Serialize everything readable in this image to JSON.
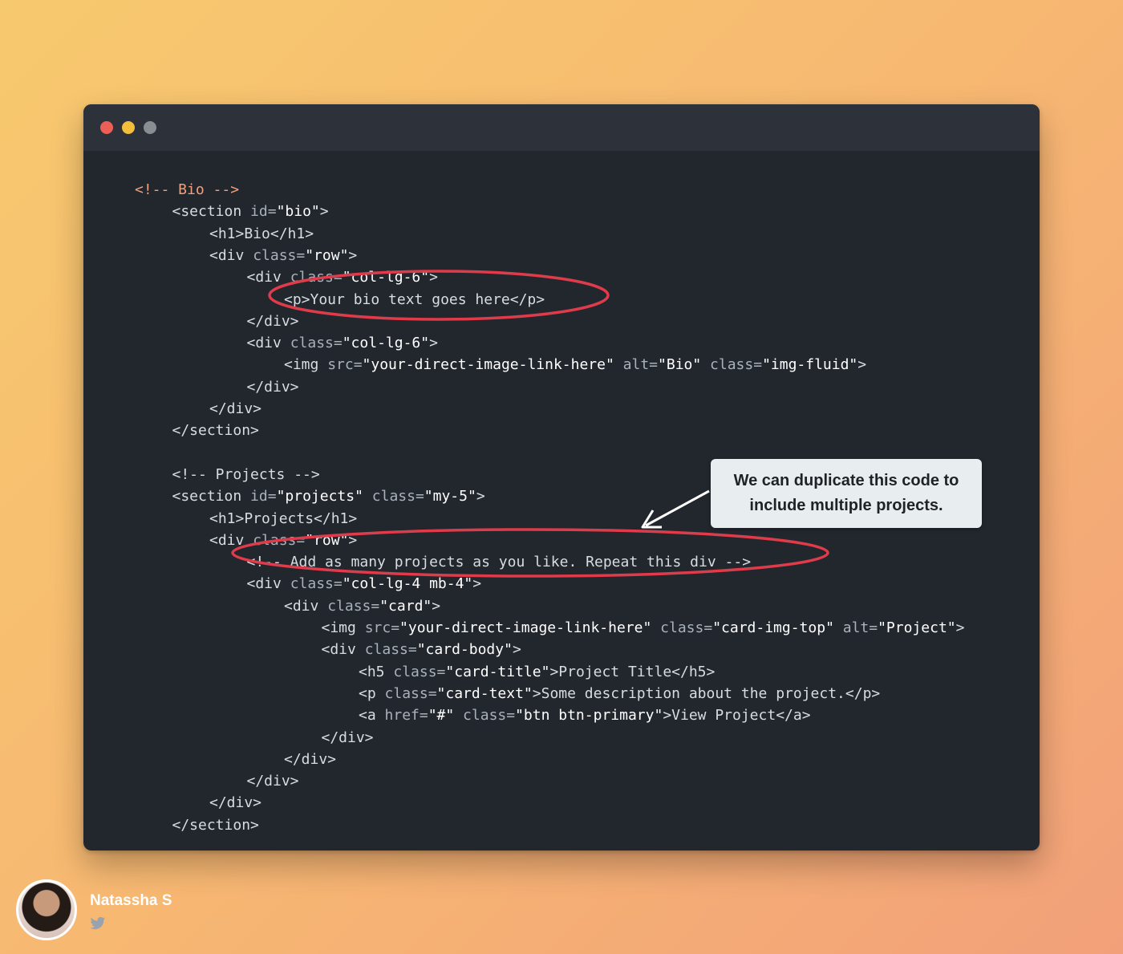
{
  "author": {
    "name": "Natassha S",
    "social_icon": "twitter-icon"
  },
  "window": {
    "controls": [
      "close",
      "minimize",
      "maximize"
    ],
    "colors": {
      "close": "#ec5f57",
      "minimize": "#f3be3b",
      "maximize": "#8a8d91"
    }
  },
  "callout": {
    "text": "We can duplicate this code to include multiple projects."
  },
  "colors": {
    "background_start": "#f7c96e",
    "background_end": "#f2a079",
    "editor_bg": "#22272e",
    "titlebar_bg": "#2d323a",
    "tag": "#d8dce2",
    "attr": "#a9b1bb",
    "string": "#ffffff",
    "comment": "#f0a07a",
    "highlight": "#e03b4a"
  },
  "code_lines": [
    {
      "indent": 0,
      "tokens": [
        {
          "t": "<!-- Bio -->",
          "c": "comment"
        }
      ]
    },
    {
      "indent": 1,
      "tokens": [
        {
          "t": "<section ",
          "c": "tag"
        },
        {
          "t": "id=",
          "c": "attr"
        },
        {
          "t": "\"bio\"",
          "c": "string"
        },
        {
          "t": ">",
          "c": "tag"
        }
      ]
    },
    {
      "indent": 2,
      "tokens": [
        {
          "t": "<h1>Bio</h1>",
          "c": "tag"
        }
      ]
    },
    {
      "indent": 2,
      "tokens": [
        {
          "t": "<div ",
          "c": "tag"
        },
        {
          "t": "class=",
          "c": "attr"
        },
        {
          "t": "\"row\"",
          "c": "string"
        },
        {
          "t": ">",
          "c": "tag"
        }
      ]
    },
    {
      "indent": 3,
      "tokens": [
        {
          "t": "<div ",
          "c": "tag"
        },
        {
          "t": "class=",
          "c": "attr"
        },
        {
          "t": "\"col-lg-6\"",
          "c": "string"
        },
        {
          "t": ">",
          "c": "tag"
        }
      ]
    },
    {
      "indent": 4,
      "tokens": [
        {
          "t": "<p>Your bio text goes here</p>",
          "c": "tag"
        }
      ]
    },
    {
      "indent": 3,
      "tokens": [
        {
          "t": "</div>",
          "c": "tag"
        }
      ]
    },
    {
      "indent": 3,
      "tokens": [
        {
          "t": "<div ",
          "c": "tag"
        },
        {
          "t": "class=",
          "c": "attr"
        },
        {
          "t": "\"col-lg-6\"",
          "c": "string"
        },
        {
          "t": ">",
          "c": "tag"
        }
      ]
    },
    {
      "indent": 4,
      "tokens": [
        {
          "t": "<img ",
          "c": "tag"
        },
        {
          "t": "src=",
          "c": "attr"
        },
        {
          "t": "\"your-direct-image-link-here\"",
          "c": "string"
        },
        {
          "t": " alt=",
          "c": "attr"
        },
        {
          "t": "\"Bio\"",
          "c": "string"
        },
        {
          "t": " class=",
          "c": "attr"
        },
        {
          "t": "\"img-fluid\"",
          "c": "string"
        },
        {
          "t": ">",
          "c": "tag"
        }
      ]
    },
    {
      "indent": 3,
      "tokens": [
        {
          "t": "</div>",
          "c": "tag"
        }
      ]
    },
    {
      "indent": 2,
      "tokens": [
        {
          "t": "</div>",
          "c": "tag"
        }
      ]
    },
    {
      "indent": 1,
      "tokens": [
        {
          "t": "</section>",
          "c": "tag"
        }
      ]
    },
    {
      "indent": 0,
      "tokens": []
    },
    {
      "indent": 1,
      "tokens": [
        {
          "t": "<!-- Projects -->",
          "c": "tag"
        }
      ]
    },
    {
      "indent": 1,
      "tokens": [
        {
          "t": "<section ",
          "c": "tag"
        },
        {
          "t": "id=",
          "c": "attr"
        },
        {
          "t": "\"projects\"",
          "c": "string"
        },
        {
          "t": " class=",
          "c": "attr"
        },
        {
          "t": "\"my-5\"",
          "c": "string"
        },
        {
          "t": ">",
          "c": "tag"
        }
      ]
    },
    {
      "indent": 2,
      "tokens": [
        {
          "t": "<h1>Projects</h1>",
          "c": "tag"
        }
      ]
    },
    {
      "indent": 2,
      "tokens": [
        {
          "t": "<div ",
          "c": "tag"
        },
        {
          "t": "class=",
          "c": "attr"
        },
        {
          "t": "\"row\"",
          "c": "string"
        },
        {
          "t": ">",
          "c": "tag"
        }
      ]
    },
    {
      "indent": 3,
      "tokens": [
        {
          "t": "<!-- Add as many projects as you like. Repeat this div -->",
          "c": "tag"
        }
      ]
    },
    {
      "indent": 3,
      "tokens": [
        {
          "t": "<div ",
          "c": "tag"
        },
        {
          "t": "class=",
          "c": "attr"
        },
        {
          "t": "\"col-lg-4 mb-4\"",
          "c": "string"
        },
        {
          "t": ">",
          "c": "tag"
        }
      ]
    },
    {
      "indent": 4,
      "tokens": [
        {
          "t": "<div ",
          "c": "tag"
        },
        {
          "t": "class=",
          "c": "attr"
        },
        {
          "t": "\"card\"",
          "c": "string"
        },
        {
          "t": ">",
          "c": "tag"
        }
      ]
    },
    {
      "indent": 5,
      "tokens": [
        {
          "t": "<img ",
          "c": "tag"
        },
        {
          "t": "src=",
          "c": "attr"
        },
        {
          "t": "\"your-direct-image-link-here\"",
          "c": "string"
        },
        {
          "t": " class=",
          "c": "attr"
        },
        {
          "t": "\"card-img-top\"",
          "c": "string"
        },
        {
          "t": " alt=",
          "c": "attr"
        },
        {
          "t": "\"Project\"",
          "c": "string"
        },
        {
          "t": ">",
          "c": "tag"
        }
      ]
    },
    {
      "indent": 5,
      "tokens": [
        {
          "t": "<div ",
          "c": "tag"
        },
        {
          "t": "class=",
          "c": "attr"
        },
        {
          "t": "\"card-body\"",
          "c": "string"
        },
        {
          "t": ">",
          "c": "tag"
        }
      ]
    },
    {
      "indent": 6,
      "tokens": [
        {
          "t": "<h5 ",
          "c": "tag"
        },
        {
          "t": "class=",
          "c": "attr"
        },
        {
          "t": "\"card-title\"",
          "c": "string"
        },
        {
          "t": ">Project Title</h5>",
          "c": "tag"
        }
      ]
    },
    {
      "indent": 6,
      "tokens": [
        {
          "t": "<p ",
          "c": "tag"
        },
        {
          "t": "class=",
          "c": "attr"
        },
        {
          "t": "\"card-text\"",
          "c": "string"
        },
        {
          "t": ">Some description about the project.</p>",
          "c": "tag"
        }
      ]
    },
    {
      "indent": 6,
      "tokens": [
        {
          "t": "<a ",
          "c": "tag"
        },
        {
          "t": "href=",
          "c": "attr"
        },
        {
          "t": "\"#\"",
          "c": "string"
        },
        {
          "t": " class=",
          "c": "attr"
        },
        {
          "t": "\"btn btn-primary\"",
          "c": "string"
        },
        {
          "t": ">View Project</a>",
          "c": "tag"
        }
      ]
    },
    {
      "indent": 5,
      "tokens": [
        {
          "t": "</div>",
          "c": "tag"
        }
      ]
    },
    {
      "indent": 4,
      "tokens": [
        {
          "t": "</div>",
          "c": "tag"
        }
      ]
    },
    {
      "indent": 3,
      "tokens": [
        {
          "t": "</div>",
          "c": "tag"
        }
      ]
    },
    {
      "indent": 2,
      "tokens": [
        {
          "t": "</div>",
          "c": "tag"
        }
      ]
    },
    {
      "indent": 1,
      "tokens": [
        {
          "t": "</section>",
          "c": "tag"
        }
      ]
    }
  ]
}
